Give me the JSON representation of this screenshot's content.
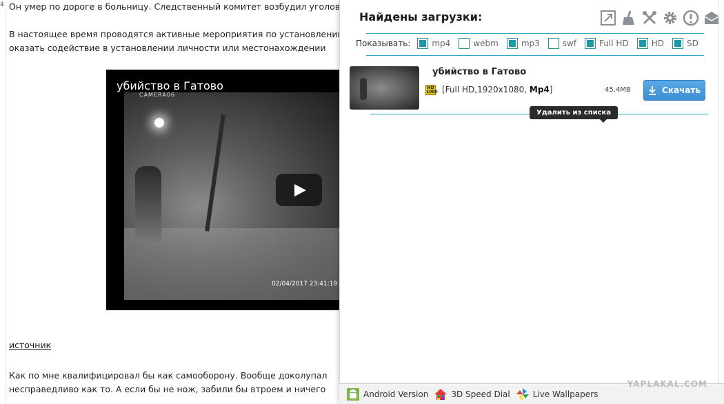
{
  "article": {
    "margin_num": "4",
    "lines": [
      "Он умер по дороге в больницу. Следственный комитет возбудил уголовное",
      "В настоящее время проводятся активные мероприятия по установлению",
      "оказать содействие в установлении личности или местонахождении",
      "Как по мне квалифицировал бы как самооборону. Вообще доколупал",
      "несправедливо как то. А если бы не нож, забили бы втроем и ничего"
    ],
    "source_link": "источник",
    "video": {
      "title": "убийство в Гатово",
      "camera": "CAMERA06",
      "timestamp": "02/04/2017 23:41:19"
    }
  },
  "panel": {
    "title": "Найдены загрузки:",
    "toolbar": [
      "expand-icon",
      "broom-icon",
      "tools-icon",
      "gear-icon",
      "alert-icon",
      "mail-icon"
    ],
    "filters": {
      "label": "Показывать:",
      "options": [
        {
          "name": "mp4",
          "checked": true
        },
        {
          "name": "webm",
          "checked": false
        },
        {
          "name": "mp3",
          "checked": true
        },
        {
          "name": "swf",
          "checked": false
        },
        {
          "name": "Full HD",
          "checked": true
        },
        {
          "name": "HD",
          "checked": true
        },
        {
          "name": "SD",
          "checked": true
        }
      ]
    },
    "item": {
      "title": "убийство в Гатово",
      "badge": "HD 1080",
      "meta_prefix": "[Full HD,1920x1080, ",
      "meta_format": "Mp4",
      "meta_suffix": "]",
      "size": "45.4MB",
      "download_label": "Скачать",
      "tooltip": "Удалить из списка"
    }
  },
  "bottombar": {
    "links": [
      "Android Version",
      "3D Speed Dial",
      "Live Wallpapers"
    ]
  },
  "watermark": "YAPLAKAL.COM",
  "colors": {
    "accent": "#2aa9c0",
    "button": "#3e8fd4",
    "checkbox": "#1e97a8"
  }
}
